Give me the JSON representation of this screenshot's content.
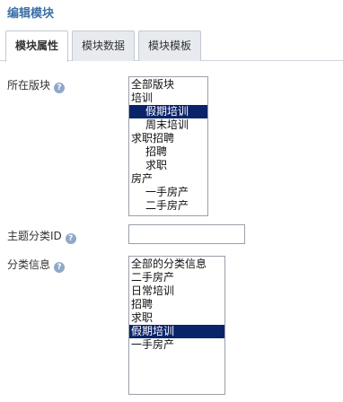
{
  "page": {
    "title": "编辑模块"
  },
  "tabs": [
    {
      "label": "模块属性",
      "active": true
    },
    {
      "label": "模块数据",
      "active": false
    },
    {
      "label": "模块模板",
      "active": false
    }
  ],
  "help_glyph": "?",
  "fields": {
    "block": {
      "label": "所在版块",
      "options": [
        {
          "text": "全部版块",
          "level": 1,
          "selected": false
        },
        {
          "text": "培训",
          "level": 1,
          "selected": false
        },
        {
          "text": "假期培训",
          "level": 2,
          "selected": true
        },
        {
          "text": "周末培训",
          "level": 2,
          "selected": false
        },
        {
          "text": "求职招聘",
          "level": 1,
          "selected": false
        },
        {
          "text": "招聘",
          "level": 2,
          "selected": false
        },
        {
          "text": "求职",
          "level": 2,
          "selected": false
        },
        {
          "text": "房产",
          "level": 1,
          "selected": false
        },
        {
          "text": "一手房产",
          "level": 2,
          "selected": false
        },
        {
          "text": "二手房产",
          "level": 2,
          "selected": false
        }
      ]
    },
    "topic_category_id": {
      "label": "主题分类ID",
      "value": "",
      "placeholder": ""
    },
    "category_info": {
      "label": "分类信息",
      "options": [
        {
          "text": "全部的分类信息",
          "selected": false
        },
        {
          "text": "二手房产",
          "selected": false
        },
        {
          "text": "日常培训",
          "selected": false
        },
        {
          "text": "招聘",
          "selected": false
        },
        {
          "text": "求职",
          "selected": false
        },
        {
          "text": "假期培训",
          "selected": true
        },
        {
          "text": "一手房产",
          "selected": false
        }
      ]
    }
  },
  "colors": {
    "title": "#3d6fa8",
    "selection": "#0a246a",
    "help_icon": "#8ea8c8",
    "tab_inactive": "#e7eaef"
  }
}
